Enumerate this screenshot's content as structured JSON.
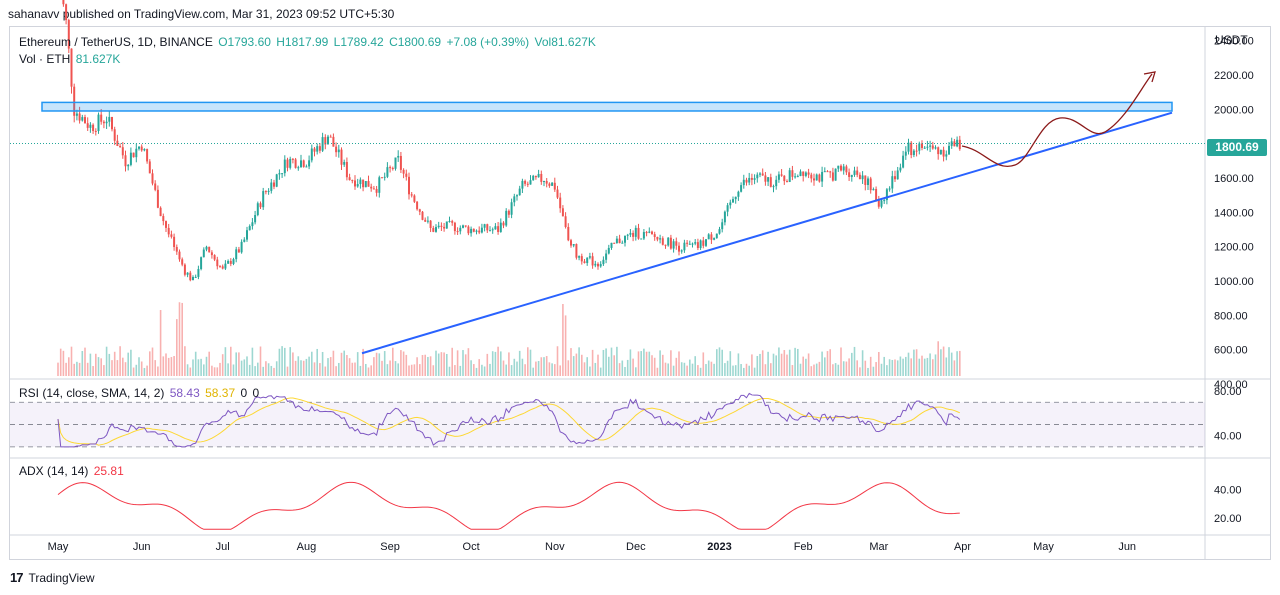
{
  "header": {
    "published": "sahanavv published on TradingView.com, Mar 31, 2023 09:52 UTC+5:30"
  },
  "legend": {
    "symbol": "Ethereum / TetherUS, 1D, BINANCE",
    "open": "O1793.60",
    "high": "H1817.99",
    "low": "L1789.42",
    "close": "C1800.69",
    "change": "+7.08 (+0.39%)",
    "vol": "Vol81.627K",
    "vol_label": "Vol · ETH",
    "vol_value": "81.627K"
  },
  "rsi_legend": {
    "label": "RSI (14, close, SMA, 14, 2)",
    "rsi": "58.43",
    "sma": "58.37",
    "z1": "0",
    "z2": "0"
  },
  "adx_legend": {
    "label": "ADX (14, 14)",
    "value": "25.81"
  },
  "price_tag": "1800.69",
  "currency": "USDT",
  "footer": {
    "brand": "TradingView"
  },
  "colors": {
    "up": "#26a69a",
    "down": "#ef5350",
    "trendline": "#2962ff",
    "zone": "#2196f3",
    "rsi": "#7e57c2",
    "rsi_sma": "#fdd835",
    "adx": "#f23645",
    "projection": "#8b1a1a"
  },
  "chart_data": {
    "type": "candlestick",
    "price_axis": {
      "ticks": [
        "2400.00",
        "2200.00",
        "2000.00",
        "1800.00",
        "1600.00",
        "1400.00",
        "1200.00",
        "1000.00",
        "800.00",
        "600.00",
        "400.00"
      ],
      "ylim": [
        400,
        2450
      ]
    },
    "rsi_axis": {
      "ticks": [
        "80.00",
        "40.00"
      ],
      "ylim": [
        20,
        90
      ],
      "bands": [
        70,
        50,
        30
      ]
    },
    "adx_axis": {
      "ticks": [
        "40.00",
        "20.00"
      ],
      "ylim": [
        8,
        62
      ]
    },
    "x_labels": [
      "May",
      "Jun",
      "Jul",
      "Aug",
      "Sep",
      "Oct",
      "Nov",
      "Dec",
      "2023",
      "Feb",
      "Mar",
      "Apr",
      "May",
      "Jun"
    ],
    "x_label_days": [
      0,
      31,
      61,
      92,
      123,
      153,
      184,
      214,
      245,
      276,
      304,
      335,
      365,
      396
    ],
    "price_path": [
      [
        0,
        2800
      ],
      [
        3,
        2500
      ],
      [
        6,
        2000
      ],
      [
        12,
        1900
      ],
      [
        18,
        1950
      ],
      [
        25,
        1700
      ],
      [
        31,
        1800
      ],
      [
        38,
        1400
      ],
      [
        45,
        1100
      ],
      [
        50,
        1000
      ],
      [
        55,
        1200
      ],
      [
        61,
        1060
      ],
      [
        68,
        1200
      ],
      [
        76,
        1500
      ],
      [
        85,
        1700
      ],
      [
        92,
        1700
      ],
      [
        100,
        1850
      ],
      [
        108,
        1600
      ],
      [
        118,
        1550
      ],
      [
        126,
        1700
      ],
      [
        131,
        1500
      ],
      [
        138,
        1300
      ],
      [
        146,
        1320
      ],
      [
        153,
        1300
      ],
      [
        163,
        1300
      ],
      [
        172,
        1550
      ],
      [
        180,
        1600
      ],
      [
        184,
        1550
      ],
      [
        188,
        1300
      ],
      [
        192,
        1150
      ],
      [
        200,
        1100
      ],
      [
        207,
        1230
      ],
      [
        214,
        1280
      ],
      [
        222,
        1250
      ],
      [
        230,
        1200
      ],
      [
        237,
        1200
      ],
      [
        245,
        1300
      ],
      [
        252,
        1550
      ],
      [
        258,
        1600
      ],
      [
        266,
        1580
      ],
      [
        276,
        1650
      ],
      [
        283,
        1600
      ],
      [
        291,
        1650
      ],
      [
        298,
        1620
      ],
      [
        304,
        1450
      ],
      [
        308,
        1550
      ],
      [
        314,
        1760
      ],
      [
        320,
        1780
      ],
      [
        327,
        1760
      ],
      [
        334,
        1800
      ]
    ],
    "zone": {
      "from_day": 0,
      "to_day": 472,
      "low": 1990,
      "high": 2040
    },
    "trendline": {
      "points": [
        [
          142,
          550
        ],
        [
          472,
          1980
        ]
      ]
    },
    "current_price": 1800.69
  }
}
